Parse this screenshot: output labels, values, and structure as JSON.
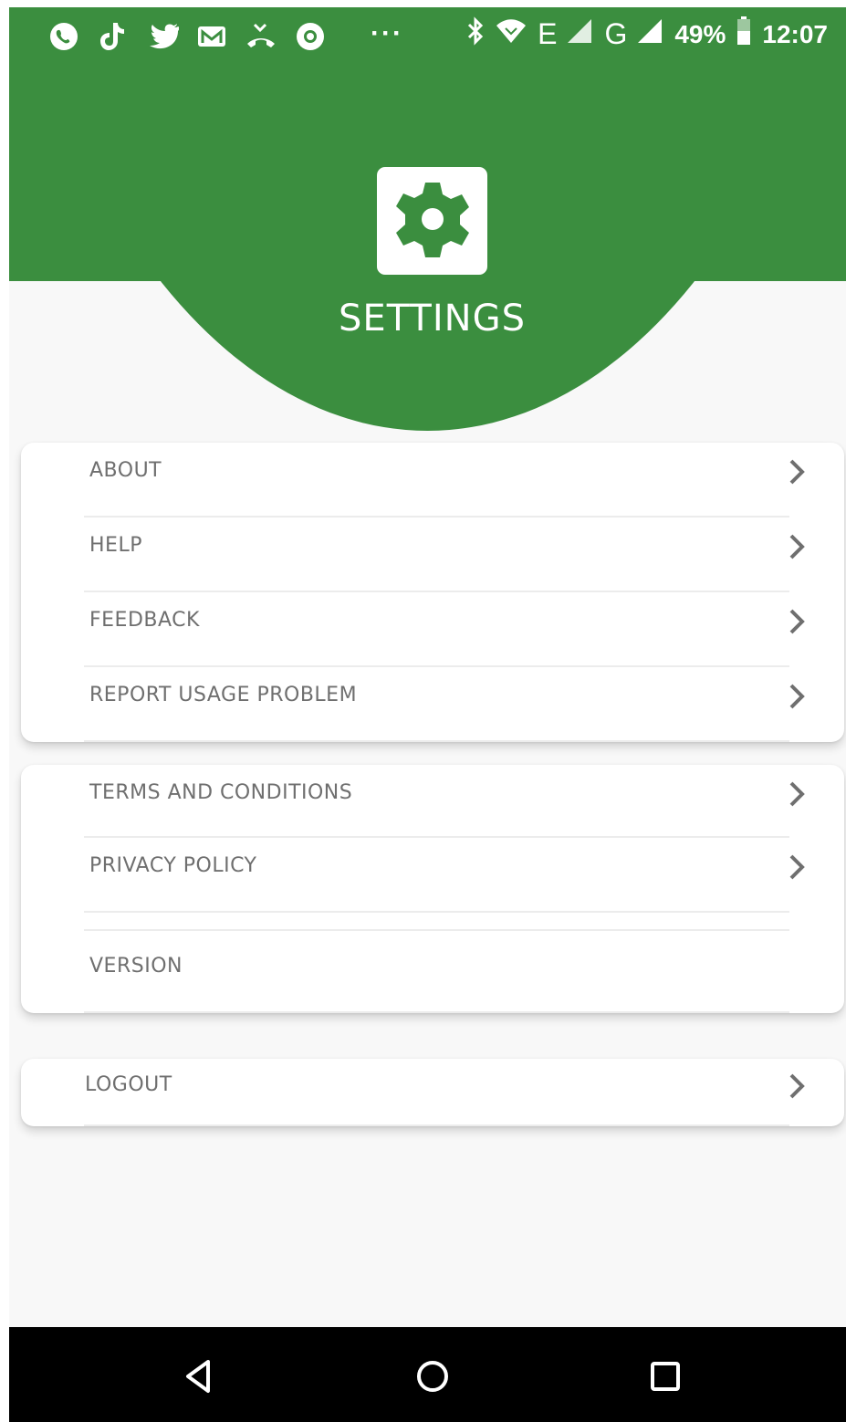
{
  "colors": {
    "header_green": "#3b8e3f",
    "label_gray": "#6f6f6f"
  },
  "status_bar": {
    "left_icons": [
      "whatsapp-icon",
      "tiktok-icon",
      "twitter-icon",
      "gmail-icon",
      "missed-call-icon",
      "chrome-icon"
    ],
    "overflow": "···",
    "network_e": "E",
    "network_g": "G",
    "battery_percent": "49%",
    "time": "12:07"
  },
  "header": {
    "title": "SETTINGS",
    "icon": "gear-icon"
  },
  "card1": {
    "items": [
      {
        "label": "ABOUT"
      },
      {
        "label": "HELP"
      },
      {
        "label": "FEEDBACK"
      },
      {
        "label": "REPORT USAGE PROBLEM"
      }
    ]
  },
  "card2": {
    "items": [
      {
        "label": "TERMS AND CONDITIONS"
      },
      {
        "label": "PRIVACY POLICY"
      },
      {
        "label": "VERSION"
      }
    ]
  },
  "card3": {
    "logout_label": "LOGOUT"
  },
  "nav_bar": {
    "buttons": [
      "back-icon",
      "home-icon",
      "recents-icon"
    ]
  }
}
